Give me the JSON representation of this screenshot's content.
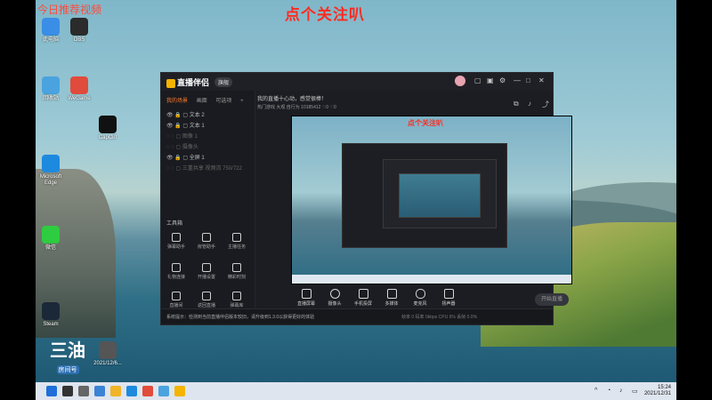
{
  "overlay": {
    "promo_text": "点个关注叭",
    "top_left_text": "今日推荐视频"
  },
  "desktop": {
    "icons": [
      {
        "label": "此电脑",
        "color": "#3a8ee6"
      },
      {
        "label": "OBS",
        "color": "#2b2b2b"
      },
      {
        "label": "回收站",
        "color": "#4aa3df"
      },
      {
        "label": "WeGame",
        "color": "#e14b3c"
      },
      {
        "label": "Microsoft Edge",
        "color": "#1d8adf"
      },
      {
        "label": "CapCut",
        "color": "#111111"
      },
      {
        "label": "Steam",
        "color": "#1b2838"
      },
      {
        "label": "微信",
        "color": "#2ecc40"
      },
      {
        "label": "2021/12/6...",
        "color": "#555555"
      }
    ]
  },
  "window": {
    "app_name": "直播伴侣",
    "version": "旗舰",
    "sidebar_tabs": [
      "我的场景",
      "画面",
      "可选项"
    ],
    "scenes": [
      {
        "label": "文本 2",
        "dim": false
      },
      {
        "label": "文本 1",
        "dim": false
      },
      {
        "label": "图像 1",
        "dim": true
      },
      {
        "label": "摄像头",
        "dim": true
      },
      {
        "label": "全屏 1",
        "dim": false
      },
      {
        "label": "三重共享 视频流 750/722",
        "dim": true
      }
    ],
    "tools_title": "工具箱",
    "tools": [
      "弹幕助手",
      "房管助手",
      "主播任务",
      "礼物连接",
      "开播设置",
      "精彩时刻",
      "直播间",
      "返回直播",
      "弹幕库"
    ],
    "top_info": "我的直播十心动，感觉很棒！",
    "top_info_tag": "",
    "top_meta": "热门游戏  大观  自行为 10185412  ♡0  ♡0",
    "bottom_buttons": [
      "直播屏幕",
      "摄像头",
      "手机投屏",
      "多媒体",
      "麦克风",
      "扬声器"
    ],
    "live_button": "开始直播",
    "status_message": "系统提示：检测到当前直播伴侣版本较旧，请升级到1.3.0以获得更好的体验",
    "status_right": "帧率 0  码率 0kbps  CPU 6%  丢帧 0.0%"
  },
  "preview": {
    "promo_text": "点个关注叭"
  },
  "taskbar": {
    "time": "15:24",
    "date": "2021/12/31"
  },
  "watermark": {
    "big": "三油",
    "small": "房间号"
  }
}
